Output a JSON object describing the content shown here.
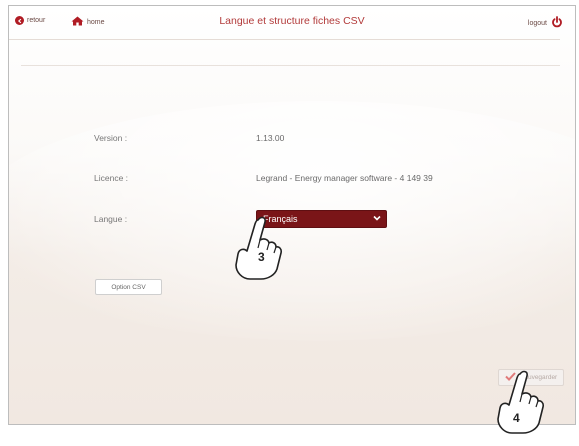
{
  "header": {
    "back_label": "retour",
    "home_label": "home",
    "title": "Langue et structure fiches CSV",
    "logout_label": "logout"
  },
  "fields": {
    "version_label": "Version :",
    "version_value": "1.13.00",
    "licence_label": "Licence :",
    "licence_value": "Legrand - Energy manager software - 4 149 39",
    "langue_label": "Langue :",
    "langue_value": "Français"
  },
  "buttons": {
    "option_csv": "Option CSV",
    "save": "Sauvegarder"
  },
  "callouts": {
    "step3": "3",
    "step4": "4"
  },
  "colors": {
    "accent": "#b01c24",
    "select_bg": "#7a1518",
    "title": "#b23a3a"
  },
  "icons": {
    "back": "back-arrow-circle-icon",
    "home": "home-icon",
    "logout": "power-icon",
    "save": "checkmark-icon",
    "select": "chevron-down-icon",
    "pointer": "pointing-hand-icon"
  }
}
